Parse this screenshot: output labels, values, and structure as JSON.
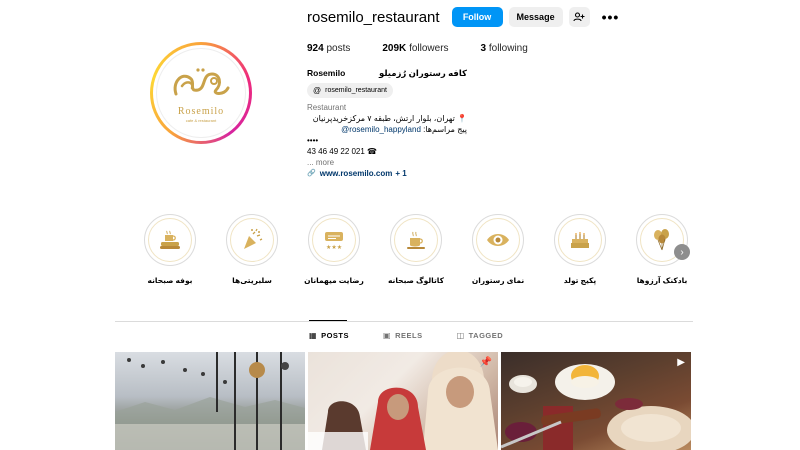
{
  "profile": {
    "username": "rosemilo_restaurant",
    "follow_label": "Follow",
    "message_label": "Message",
    "add_user_icon": "add-user-icon",
    "more_label": "•••",
    "avatar_brand": "Rosemilo",
    "avatar_sub": "cafe & restaurant"
  },
  "stats": {
    "posts_count": "924",
    "posts_label": "posts",
    "followers_count": "209K",
    "followers_label": "followers",
    "following_count": "3",
    "following_label": "following"
  },
  "bio": {
    "name": "Rosemilo",
    "name_fa": "کافه رستوران رُزمیلو",
    "threads_handle": "rosemilo_restaurant",
    "category": "Restaurant",
    "address": "تهران، بلوار ارتش، طبقه ۷ مرکزخریدپرنیان",
    "events_prefix": "پیج مراسم‌ها:",
    "events_handle": "rosemilo_happyland@",
    "dots": "••••",
    "phone": "43 46 49 22 021 ☎",
    "more_label": "... more",
    "url": "www.rosemilo.com",
    "url_extra": "+ 1"
  },
  "highlights": [
    {
      "label": "بوفه صبحانه",
      "icon": "breakfast-tray-icon"
    },
    {
      "label": "سلبریتی‌ها",
      "icon": "party-popper-icon"
    },
    {
      "label": "رضایت میهمانان",
      "icon": "rating-stars-icon"
    },
    {
      "label": "کاتالوگ صبحانه",
      "icon": "coffee-cup-icon"
    },
    {
      "label": "نمای رستوران",
      "icon": "eye-icon"
    },
    {
      "label": "پکیج تولد",
      "icon": "cake-icon"
    },
    {
      "label": "بادکنک آرزوها",
      "icon": "balloons-icon"
    }
  ],
  "tabs": [
    {
      "label": "POSTS",
      "icon": "grid-icon",
      "active": true
    },
    {
      "label": "REELS",
      "icon": "reels-icon",
      "active": false
    },
    {
      "label": "TAGGED",
      "icon": "tagged-icon",
      "active": false
    }
  ],
  "posts": [
    {
      "name": "post-terrace-view",
      "badge": ""
    },
    {
      "name": "post-guests-portrait",
      "badge": "pin-icon"
    },
    {
      "name": "post-food-platter",
      "badge": "reel-icon"
    }
  ],
  "colors": {
    "accent_blue": "#0095f6",
    "link_blue": "#00376b",
    "gold": "#c9a24a"
  }
}
